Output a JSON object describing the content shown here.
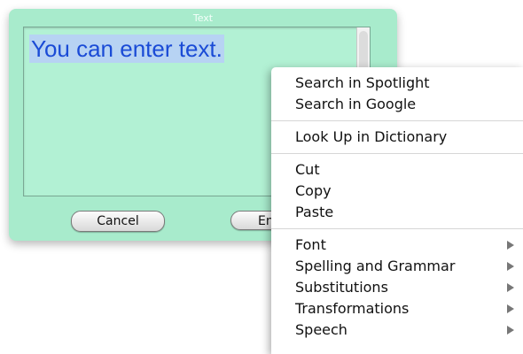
{
  "dialog": {
    "title": "Text",
    "text_value": "You can enter text.",
    "cancel_label": "Cancel",
    "enter_label_visible": "En"
  },
  "context_menu": {
    "section1": [
      "Search in Spotlight",
      "Search in Google"
    ],
    "section2": [
      "Look Up in Dictionary"
    ],
    "section3": [
      "Cut",
      "Copy",
      "Paste"
    ],
    "section4": [
      "Font",
      "Spelling and Grammar",
      "Substitutions",
      "Transformations",
      "Speech"
    ]
  },
  "icons": {
    "submenu": "chevron-right-icon"
  },
  "colors": {
    "dialog_bg": "#a8ebcc",
    "text_color": "#1a4bd6",
    "selection": "#b7d3f3"
  }
}
